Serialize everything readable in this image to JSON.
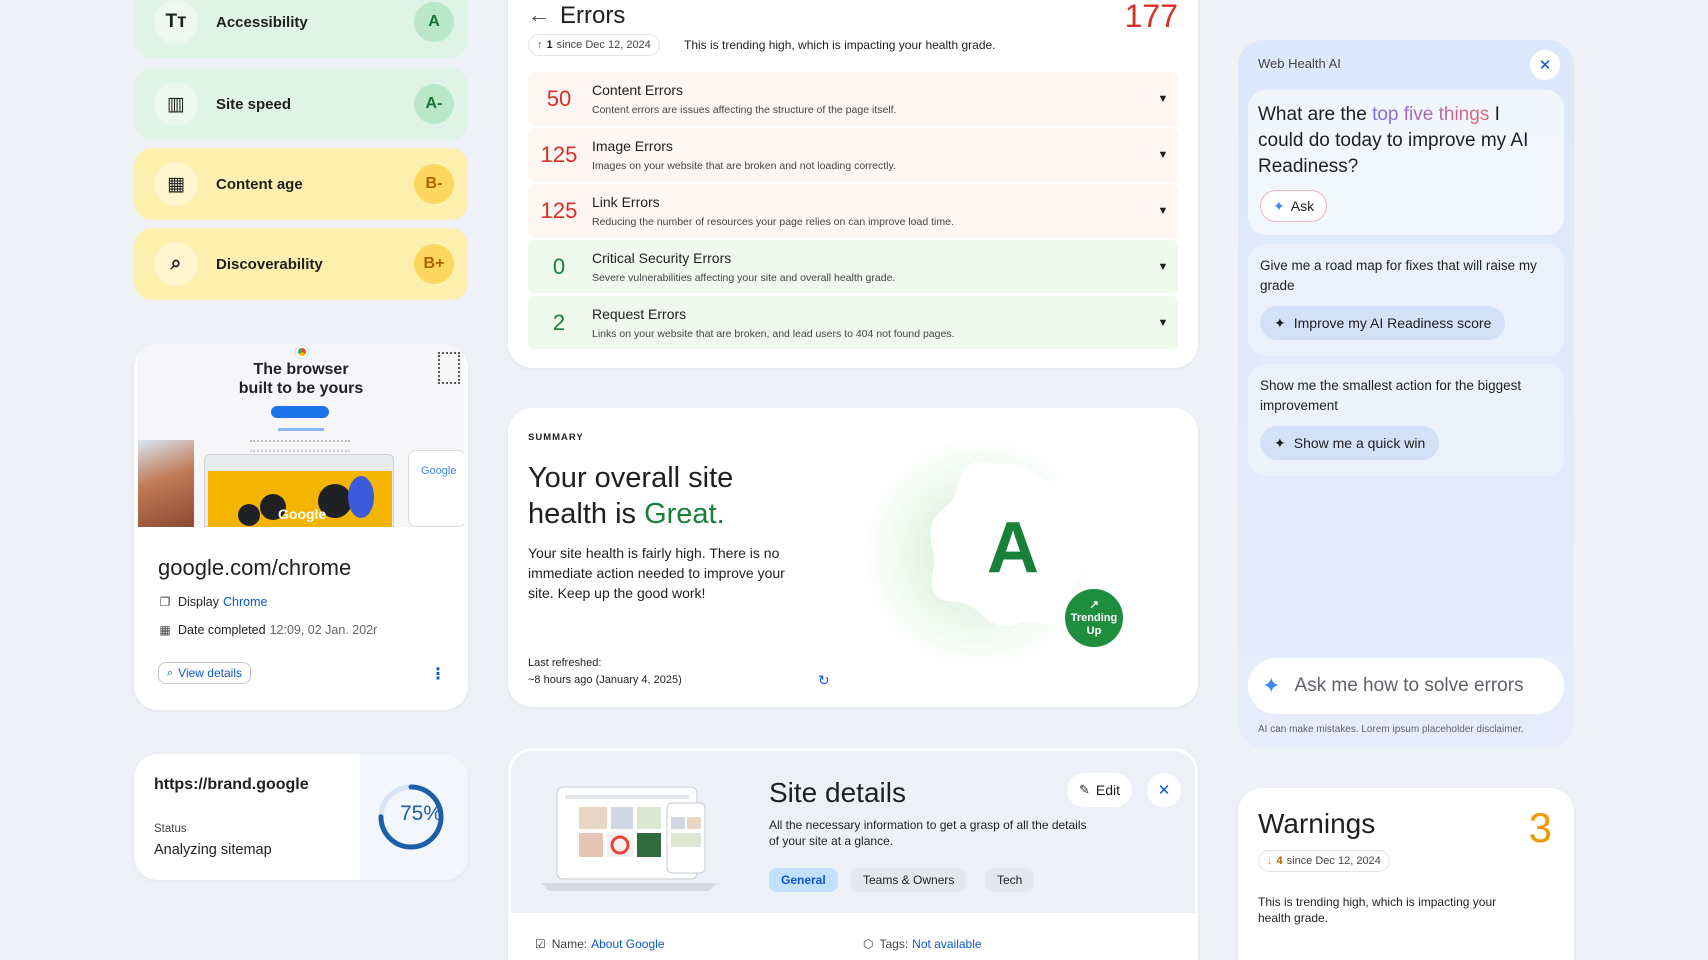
{
  "grades": [
    {
      "label": "Accessibility",
      "grade": "A",
      "icon": "text-size-icon",
      "glyph": "Tт",
      "tone": "green"
    },
    {
      "label": "Site speed",
      "grade": "A-",
      "icon": "speed-chart-icon",
      "glyph": "▥",
      "tone": "green"
    },
    {
      "label": "Content age",
      "grade": "B-",
      "icon": "calendar-icon",
      "glyph": "▦",
      "tone": "yellow"
    },
    {
      "label": "Discoverability",
      "grade": "B+",
      "icon": "search-icon",
      "glyph": "⌕",
      "tone": "yellow"
    }
  ],
  "chrome_card": {
    "hero_line1": "The browser",
    "hero_line2": "built to be yours",
    "hero_logo_word": "Google",
    "hero_phone_word": "Google",
    "domain": "google.com/chrome",
    "display_label": "Display",
    "display_value": "Chrome",
    "date_label": "Date completed",
    "date_value": "12:09, 02 Jan. 202r",
    "view_details": "View details"
  },
  "brand_card": {
    "url": "https://brand.google",
    "status_label": "Status",
    "status_value": "Analyzing sitemap",
    "progress_label": "75%",
    "progress": 0.75
  },
  "errors": {
    "title": "Errors",
    "total": "177",
    "trend_count": "1",
    "trend_since": "since Dec 12, 2024",
    "description": "This is trending high, which is impacting your health grade.",
    "rows": [
      {
        "count": "50",
        "name": "Content Errors",
        "sub": "Content errors are issues affecting the structure of the page itself.",
        "tone": "red"
      },
      {
        "count": "125",
        "name": "Image Errors",
        "sub": "Images on your website that are broken and not loading correctly.",
        "tone": "red"
      },
      {
        "count": "125",
        "name": "Link Errors",
        "sub": "Reducing the number of resources your page relies on can improve load time.",
        "tone": "red"
      },
      {
        "count": "0",
        "name": "Critical Security Errors",
        "sub": "Severe vulnerabilities affecting your site and overall health grade.",
        "tone": "green"
      },
      {
        "count": "2",
        "name": "Request Errors",
        "sub": "Links on your website that are broken, and lead users to 404 not found pages.",
        "tone": "green"
      }
    ]
  },
  "summary": {
    "label": "SUMMARY",
    "heading_line1": "Your overall site",
    "heading_line2_prefix": "health is ",
    "heading_highlight": "Great.",
    "body": "Your site health is fairly high. There is no immediate action needed to improve your site. Keep up the good work!",
    "refreshed_label": "Last refreshed:",
    "refreshed_value": "~8 hours ago (January 4, 2025)",
    "grade": "A",
    "trend_line1": "Trending",
    "trend_line2": "Up"
  },
  "site_details": {
    "title": "Site details",
    "description": "All the necessary information to get a grasp of all the details of your site at a glance.",
    "edit_label": "Edit",
    "tabs": [
      "General",
      "Teams & Owners",
      "Tech"
    ],
    "active_tab": "General",
    "name_label": "Name:",
    "name_value": "About Google",
    "tags_label": "Tags:",
    "tags_value": "Not available"
  },
  "ai_panel": {
    "title": "Web Health AI",
    "question_prefix": "What are the ",
    "question_highlight": "top five things",
    "question_suffix": " I could do today to improve my AI Readiness?",
    "ask_label": "Ask",
    "suggestions": [
      {
        "prompt": "Give me a road map for fixes that will raise my grade",
        "action": "Improve my AI Readiness score"
      },
      {
        "prompt": "Show me the smallest action for the biggest improvement",
        "action": "Show me a quick win"
      }
    ],
    "input_placeholder": "Ask me how to solve errors",
    "disclaimer": "AI can make mistakes. Lorem ipsum placeholder disclaimer."
  },
  "warnings": {
    "title": "Warnings",
    "count": "3",
    "trend_count": "4",
    "trend_since": "since Dec 12, 2024",
    "description": "This is trending high, which is impacting your health grade."
  },
  "colors": {
    "error_red": "#d93025",
    "good_green": "#188038",
    "warning_orange": "#f29900",
    "accent_blue": "#0b57d0"
  }
}
